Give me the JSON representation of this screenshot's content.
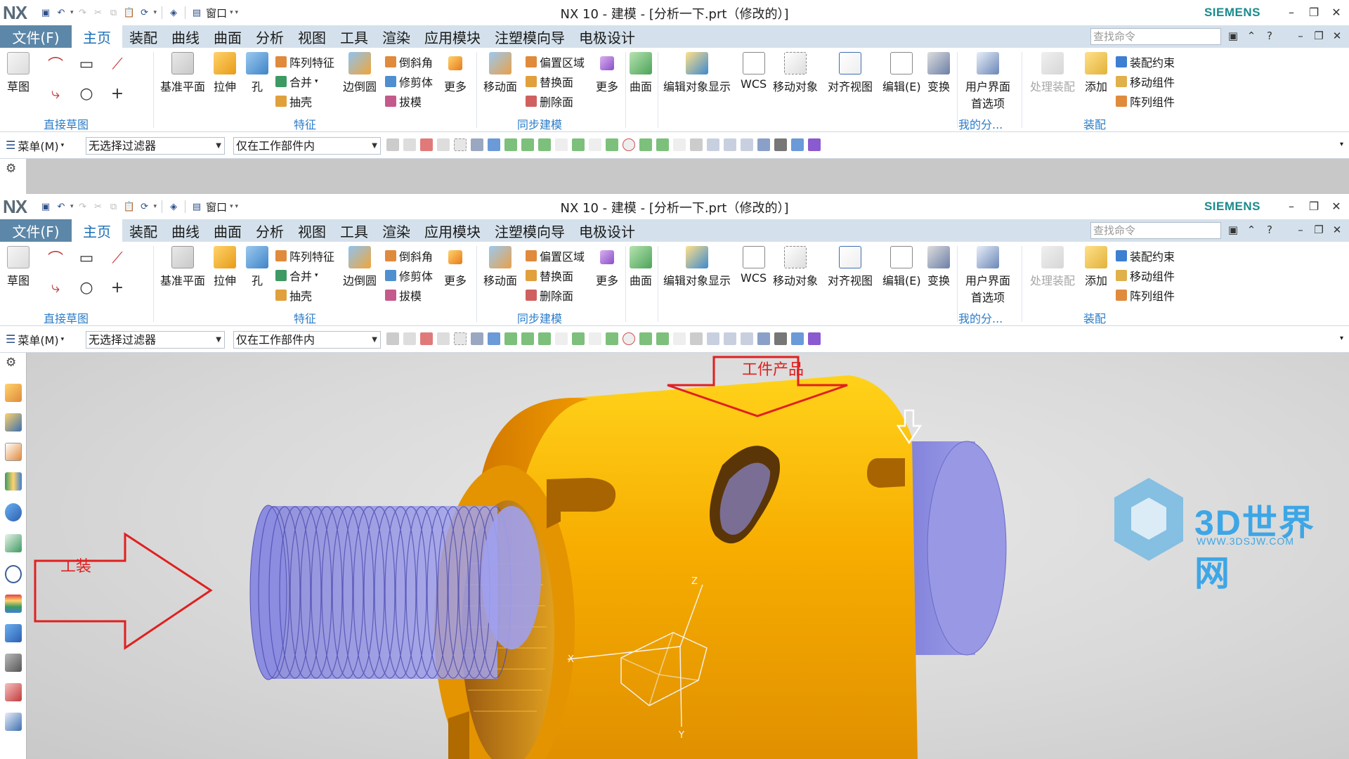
{
  "app": {
    "logo": "NX",
    "title": "NX 10 - 建模 - [分析一下.prt（修改的）]",
    "brand": "SIEMENS",
    "window_menu": "窗口",
    "controls": {
      "minimize": "–",
      "restore": "❐",
      "close": "✕"
    }
  },
  "tabs": {
    "file": "文件(F)",
    "items": [
      "主页",
      "装配",
      "曲线",
      "曲面",
      "分析",
      "视图",
      "工具",
      "渲染",
      "应用模块",
      "注塑模向导",
      "电极设计"
    ],
    "active": "主页"
  },
  "search": {
    "placeholder": "查找命令"
  },
  "ribbon": {
    "sketch": "草图",
    "group_direct_sketch": "直接草图",
    "datum_plane": "基准平面",
    "extrude": "拉伸",
    "hole": "孔",
    "pattern_feature": "阵列特征",
    "unite": "合并",
    "shell": "抽壳",
    "edge_blend": "边倒圆",
    "chamfer": "倒斜角",
    "trim_body": "修剪体",
    "draft": "拔模",
    "more": "更多",
    "group_feature": "特征",
    "move_face": "移动面",
    "offset_region": "偏置区域",
    "replace_face": "替换面",
    "delete_face": "删除面",
    "more2": "更多",
    "group_sync": "同步建模",
    "surface": "曲面",
    "edit_display": "编辑对象显示",
    "wcs": "WCS",
    "move_object": "移动对象",
    "align_view": "对齐视图",
    "edit": "编辑(E)",
    "transform": "变换",
    "ui_pref_1": "用户界面",
    "ui_pref_2": "首选项",
    "group_mine": "我的分...",
    "process_assembly": "处理装配",
    "add": "添加",
    "assembly_constraint": "装配约束",
    "move_component": "移动组件",
    "pattern_component": "阵列组件",
    "group_assembly": "装配"
  },
  "cmdbar": {
    "menu": "菜单(M)",
    "filter": "无选择过滤器",
    "scope": "仅在工作部件内"
  },
  "annotations": {
    "product": "工件产品",
    "fixture": "工装"
  },
  "watermark": {
    "text": "3D世界网",
    "url": "WWW.3DSJW.COM"
  },
  "triad": {
    "x": "X",
    "y": "Y",
    "z": "Z"
  },
  "colors": {
    "accent": "#2b7cc8",
    "file_tab": "#5c87a8",
    "tab_bar": "#d4e1ec",
    "part_orange": "#f5a800",
    "fixture_blue": "#8e8ee0",
    "annotation_red": "#e02020"
  }
}
